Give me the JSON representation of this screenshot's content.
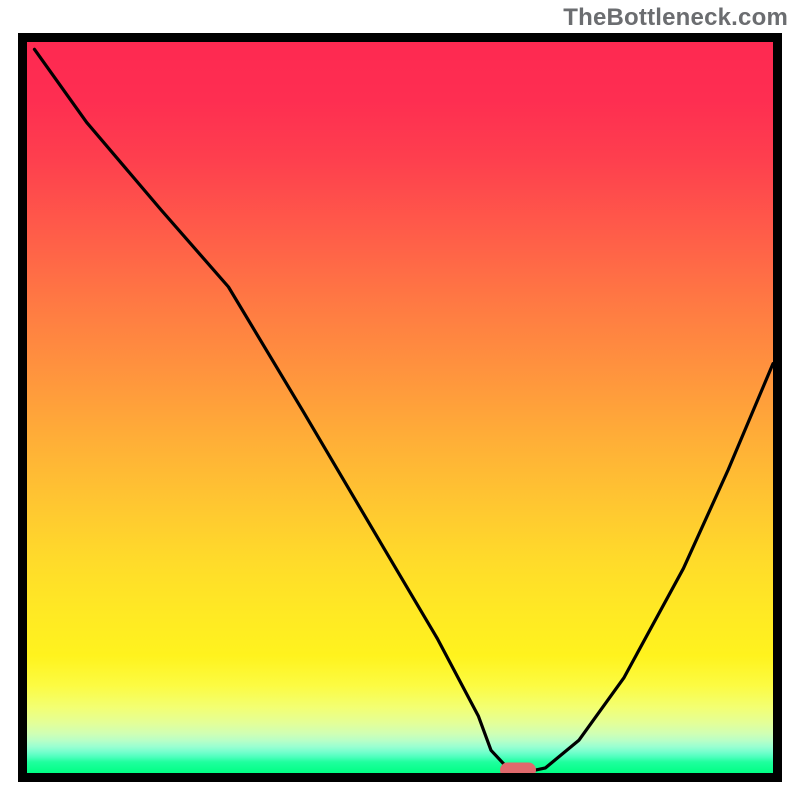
{
  "watermark": "TheBottleneck.com",
  "colors": {
    "frame_border": "#000000",
    "marker_fill": "#e0696c",
    "gradient_top": "#fe2951",
    "gradient_mid": "#ffd829",
    "gradient_bottom": "#00ff84"
  },
  "chart_data": {
    "type": "line",
    "title": "",
    "xlabel": "",
    "ylabel": "",
    "xlim": [
      0,
      100
    ],
    "ylim": [
      0,
      100
    ],
    "x": [
      1,
      8,
      18,
      27,
      37,
      47,
      55,
      60.5,
      62.2,
      64.5,
      67.2,
      69.5,
      74,
      80,
      88,
      94,
      100
    ],
    "values": [
      99,
      89,
      77,
      66.5,
      49.5,
      32.2,
      18.4,
      7.8,
      3.1,
      0.6,
      0.2,
      0.7,
      4.5,
      13,
      28,
      41.5,
      56
    ],
    "marker": {
      "x": 65.8,
      "y": 0.35
    },
    "gradient_meaning": "vertical heat gradient from red (high) to green (low)"
  }
}
